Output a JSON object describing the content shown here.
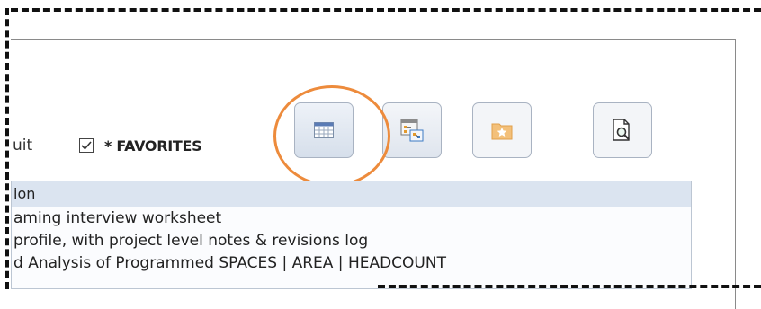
{
  "toolbar": {
    "partial_label": "uit",
    "favorites_label": "* FAVORITES",
    "favorites_checked": true,
    "buttons": [
      {
        "icon": "calendar-grid-icon",
        "highlighted": true
      },
      {
        "icon": "org-chart-window-icon",
        "highlighted": false
      },
      {
        "icon": "star-folder-icon",
        "highlighted": false
      },
      {
        "icon": "document-search-icon",
        "highlighted": false
      }
    ]
  },
  "grid": {
    "header": "ion",
    "rows": [
      "aming interview worksheet",
      "profile, with project level notes & revisions log",
      "d Analysis of Programmed SPACES | AREA | HEADCOUNT"
    ]
  },
  "colors": {
    "highlight_ring": "#ed8b3c",
    "grid_header_bg": "#dbe4f0",
    "button_border": "#a9b3c2"
  }
}
